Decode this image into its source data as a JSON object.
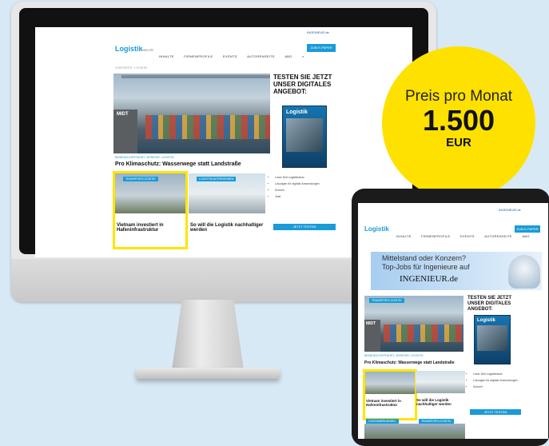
{
  "badge": {
    "line1": "Preis pro Monat",
    "price": "1.500",
    "currency": "EUR"
  },
  "site": {
    "logo": "Logistik",
    "logo_sub": "HEUTE",
    "nav": [
      "INHALTE",
      "FIRMENPROFILE",
      "EVENTS",
      "AUTORENSEITE",
      "ABO"
    ],
    "top_link": "INGENIEUR.de",
    "header_button": "ZUM E-PAPER",
    "breadcrumb": "STARTSEITE › LOGISTIK",
    "hero_kicker": "BINNENSCHIFFFAHRT, VERKEHR, LOGISTIK",
    "hero_title": "Pro Klimaschutz: Wasserwege statt Landstraße",
    "hero_sign": "MIDT",
    "promo_title": "TESTEN SIE JETZT UNSER DIGITALES ANGEBOT:",
    "mag_title": "Logistik",
    "benefits": [
      "Leser Seit Logistiknews",
      "Lösungen für digitale Anwendungen",
      "Schnell",
      "Jetzt"
    ],
    "cards": [
      {
        "tag": "TRANSPORTLOGISTIK",
        "title": "Vietnam investiert in Hafeninfrastruktur"
      },
      {
        "tag": "LOGISTIKUNTERNEHMEN",
        "title": "So will die Logistik nachhaltiger werden"
      }
    ],
    "promo_button": "JETZT TESTEN"
  },
  "tablet": {
    "ad_line1": "Mittelstand oder Konzern?",
    "ad_line2": "Top-Jobs für Ingenieure auf",
    "ad_brand": "INGENIEUR.de",
    "cards_extra": [
      "CONTAINERHANDEL",
      "TRANSPORTLOGISTIK"
    ]
  }
}
